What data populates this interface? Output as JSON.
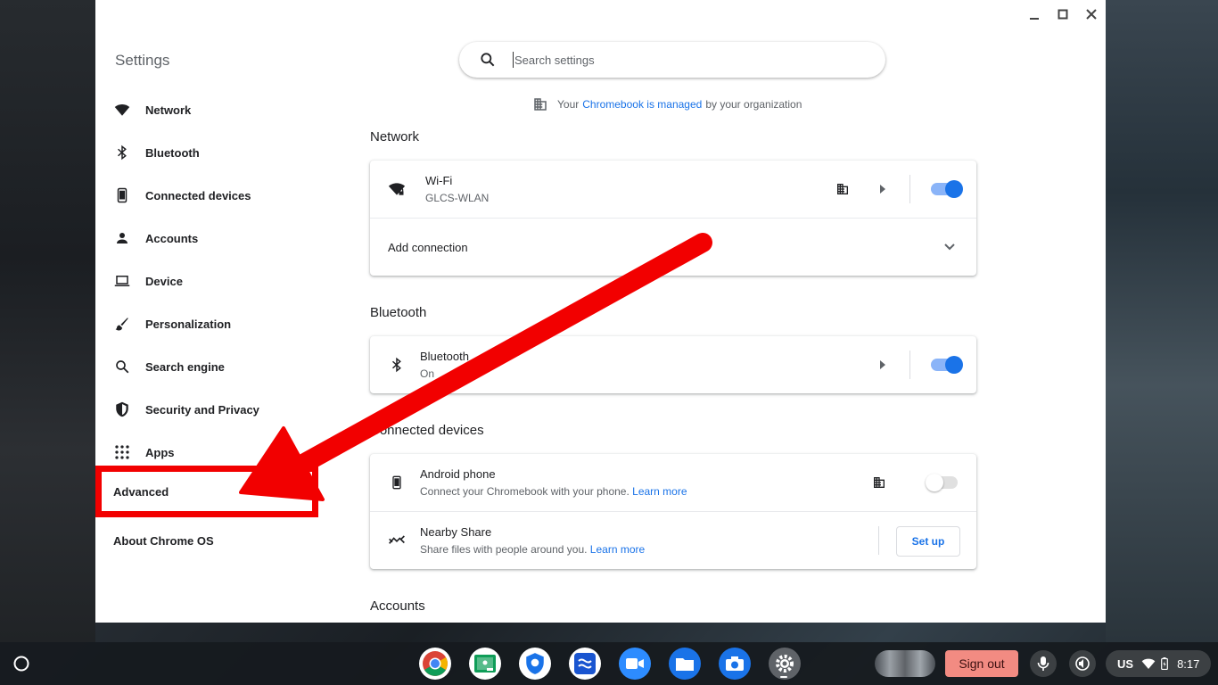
{
  "window": {
    "app_title": "Settings",
    "controls": [
      "minimize-icon",
      "maximize-icon",
      "close-icon"
    ]
  },
  "search": {
    "placeholder": "Search settings",
    "value": ""
  },
  "managed_notice": {
    "prefix": "Your",
    "link": "Chromebook is managed",
    "suffix": "by your organization"
  },
  "sidebar": {
    "items": [
      {
        "label": "Network",
        "icon": "wifi-icon"
      },
      {
        "label": "Bluetooth",
        "icon": "bluetooth-icon"
      },
      {
        "label": "Connected devices",
        "icon": "phone-icon"
      },
      {
        "label": "Accounts",
        "icon": "person-icon"
      },
      {
        "label": "Device",
        "icon": "laptop-icon"
      },
      {
        "label": "Personalization",
        "icon": "brush-icon"
      },
      {
        "label": "Search engine",
        "icon": "search-icon"
      },
      {
        "label": "Security and Privacy",
        "icon": "shield-icon"
      },
      {
        "label": "Apps",
        "icon": "apps-grid-icon"
      }
    ],
    "advanced": "Advanced",
    "about": "About Chrome OS"
  },
  "sections": {
    "network": {
      "title": "Network",
      "wifi": {
        "title": "Wi-Fi",
        "subtitle": "GLCS-WLAN",
        "enabled": true
      },
      "add_connection": "Add connection"
    },
    "bluetooth": {
      "title": "Bluetooth",
      "row": {
        "title": "Bluetooth",
        "subtitle": "On",
        "enabled": true
      }
    },
    "connected_devices": {
      "title": "Connected devices",
      "android": {
        "title": "Android phone",
        "subtitle": "Connect your Chromebook with your phone.",
        "link": "Learn more",
        "enabled": false
      },
      "nearby": {
        "title": "Nearby Share",
        "subtitle": "Share files with people around you.",
        "link": "Learn more",
        "button": "Set up"
      }
    },
    "accounts": {
      "title": "Accounts"
    }
  },
  "annotation": {
    "highlight_color": "#f20000"
  },
  "shelf": {
    "apps": [
      "chrome-icon",
      "classroom-icon",
      "security-app-icon",
      "hapara-icon",
      "zoom-icon",
      "files-icon",
      "camera-icon",
      "settings-app-icon"
    ],
    "sign_out": "Sign out",
    "ime": "US",
    "time": "8:17"
  },
  "colors": {
    "accent": "#1a73e8",
    "toggle_track": "#8ab4f8",
    "sign_out_bg": "#f28b82"
  }
}
